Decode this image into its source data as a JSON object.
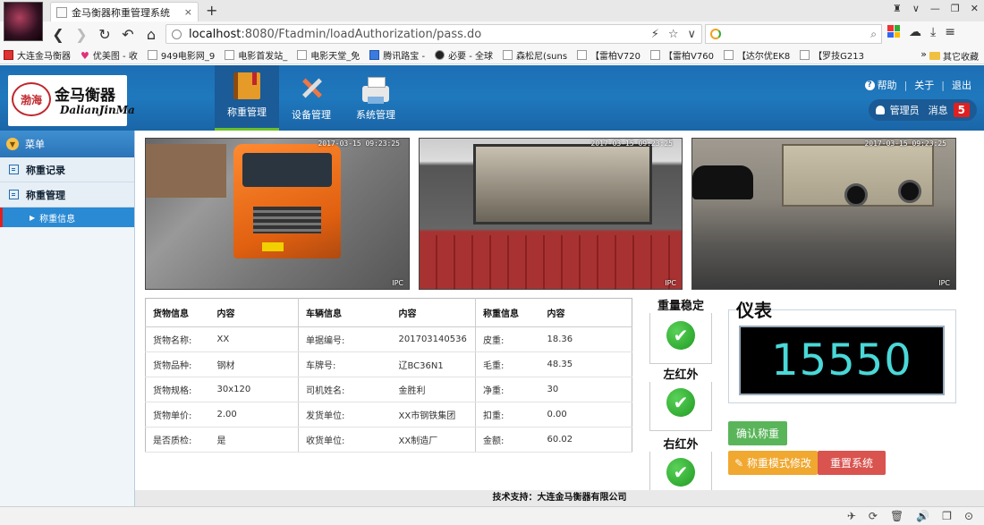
{
  "browser": {
    "tab_title": "金马衡器称重管理系统",
    "tab_close": "×",
    "new_tab": "+",
    "window_controls": [
      "♜",
      "∨",
      "—",
      "❐",
      "✕"
    ],
    "address": {
      "prefix": "localhost",
      "rest": ":8080/Ftadmin/loadAuthorization/pass.do"
    },
    "address_icons": [
      "⚡",
      "☆",
      "∨"
    ],
    "search_placeholder": "",
    "search_icon": "magnifier-icon",
    "bookmarks": [
      {
        "label": "大连金马衡器",
        "icon": "red"
      },
      {
        "label": "优美图 - 收",
        "icon": "heart"
      },
      {
        "label": "949电影网_9",
        "icon": "page"
      },
      {
        "label": "电影首发站_",
        "icon": "page"
      },
      {
        "label": "电影天堂_免",
        "icon": "page"
      },
      {
        "label": "腾讯路宝 -",
        "icon": "blue"
      },
      {
        "label": "必要 - 全球",
        "icon": "black"
      },
      {
        "label": "森松尼(suns",
        "icon": "page"
      },
      {
        "label": "【雷柏V720",
        "icon": "page"
      },
      {
        "label": "【雷柏V760",
        "icon": "page"
      },
      {
        "label": "【达尔优EK8",
        "icon": "page"
      },
      {
        "label": "【罗技G213",
        "icon": "page"
      }
    ],
    "bookmarks_more": "»",
    "bookmarks_other": "其它收藏"
  },
  "header": {
    "logo_seal": "渤海",
    "logo_name": "金马衡器",
    "logo_sub": "DalianJinMa",
    "nav": [
      {
        "label": "称重管理",
        "icon": "book-icon",
        "active": true
      },
      {
        "label": "设备管理",
        "icon": "tools-icon",
        "active": false
      },
      {
        "label": "系统管理",
        "icon": "printer-icon",
        "active": false
      }
    ],
    "links": {
      "help": "帮助",
      "about": "关于",
      "logout": "退出"
    },
    "user": "管理员",
    "messages_label": "消息",
    "messages_count": "5"
  },
  "sidebar": {
    "menu_title": "菜单",
    "items": [
      {
        "label": "称重记录"
      },
      {
        "label": "称重管理"
      }
    ],
    "sub_item": "称重信息"
  },
  "cameras": [
    {
      "stamp": "2017-03-15 09:23:25",
      "ip": "IPC"
    },
    {
      "stamp": "2017-03-15 09:23:25",
      "ip": "IPC"
    },
    {
      "stamp": "2017-03-15 09:23:25",
      "ip": "IPC"
    }
  ],
  "info_table": {
    "headers": [
      "货物信息",
      "内容",
      "车辆信息",
      "内容",
      "称重信息",
      "内容"
    ],
    "rows": [
      [
        "货物名称:",
        "XX",
        "单据编号:",
        "201703140536",
        "皮重:",
        "18.36"
      ],
      [
        "货物品种:",
        "钢材",
        "车牌号:",
        "辽BC36N1",
        "毛重:",
        "48.35"
      ],
      [
        "货物规格:",
        "30x120",
        "司机姓名:",
        "金胜利",
        "净重:",
        "30"
      ],
      [
        "货物单价:",
        "2.00",
        "发货单位:",
        "XX市钢铁集团",
        "扣重:",
        "0.00"
      ],
      [
        "是否质检:",
        "是",
        "收货单位:",
        "XX制造厂",
        "金额:",
        "60.02"
      ]
    ]
  },
  "status": {
    "stable": "重量稳定",
    "left_ir": "左红外",
    "right_ir": "右红外"
  },
  "meter": {
    "title": "仪表",
    "value": "15550"
  },
  "buttons": {
    "confirm": "确认称重",
    "mode": "✎ 称重模式修改",
    "reset": "重置系统"
  },
  "footer": "技术支持：大连金马衡器有限公司",
  "statusbar_icons": [
    "✈",
    "⟳",
    "🗑",
    "🔊",
    "❐",
    "⊙"
  ]
}
